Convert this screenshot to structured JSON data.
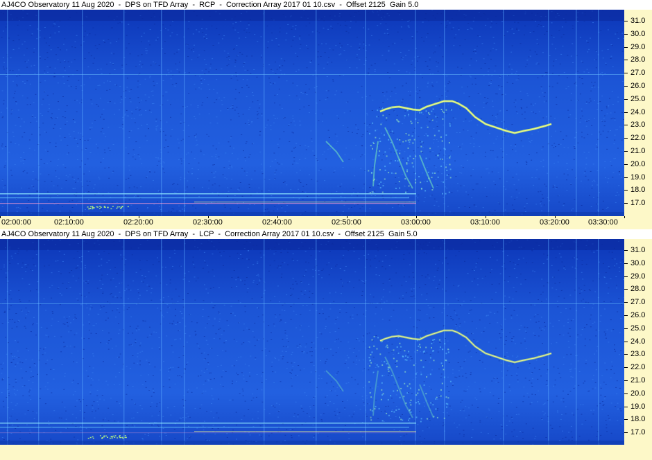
{
  "panels": [
    {
      "id": "rcp",
      "title": "AJ4CO Observatory 11 Aug 2020  -  DPS on TFD Array  -  RCP  -  Correction Array 2017 01 10.csv  -  Offset 2125  Gain 5.0"
    },
    {
      "id": "lcp",
      "title": "AJ4CO Observatory 11 Aug 2020  -  DPS on TFD Array  -  LCP  -  Correction Array 2017 01 10.csv  -  Offset 2125  Gain 5.0"
    }
  ],
  "frequency_labels": [
    "31.0",
    "30.0",
    "29.0",
    "28.0",
    "27.0",
    "26.0",
    "25.0",
    "24.0",
    "23.0",
    "22.0",
    "21.0",
    "20.0",
    "19.0",
    "18.0",
    "17.0"
  ],
  "time_labels": [
    "02:00:00",
    "02:10:00",
    "02:20:00",
    "02:30:00",
    "02:40:00",
    "02:50:00",
    "03:00:00",
    "03:10:00",
    "03:20:00",
    "03:30:00"
  ],
  "colors": {
    "background_blue": "#1d56d8",
    "deep_blue": "#0a2a9a",
    "emission_yellow": "#e6f070",
    "emission_green": "#60e0b0",
    "axis_bg": "#fdf8c8"
  }
}
